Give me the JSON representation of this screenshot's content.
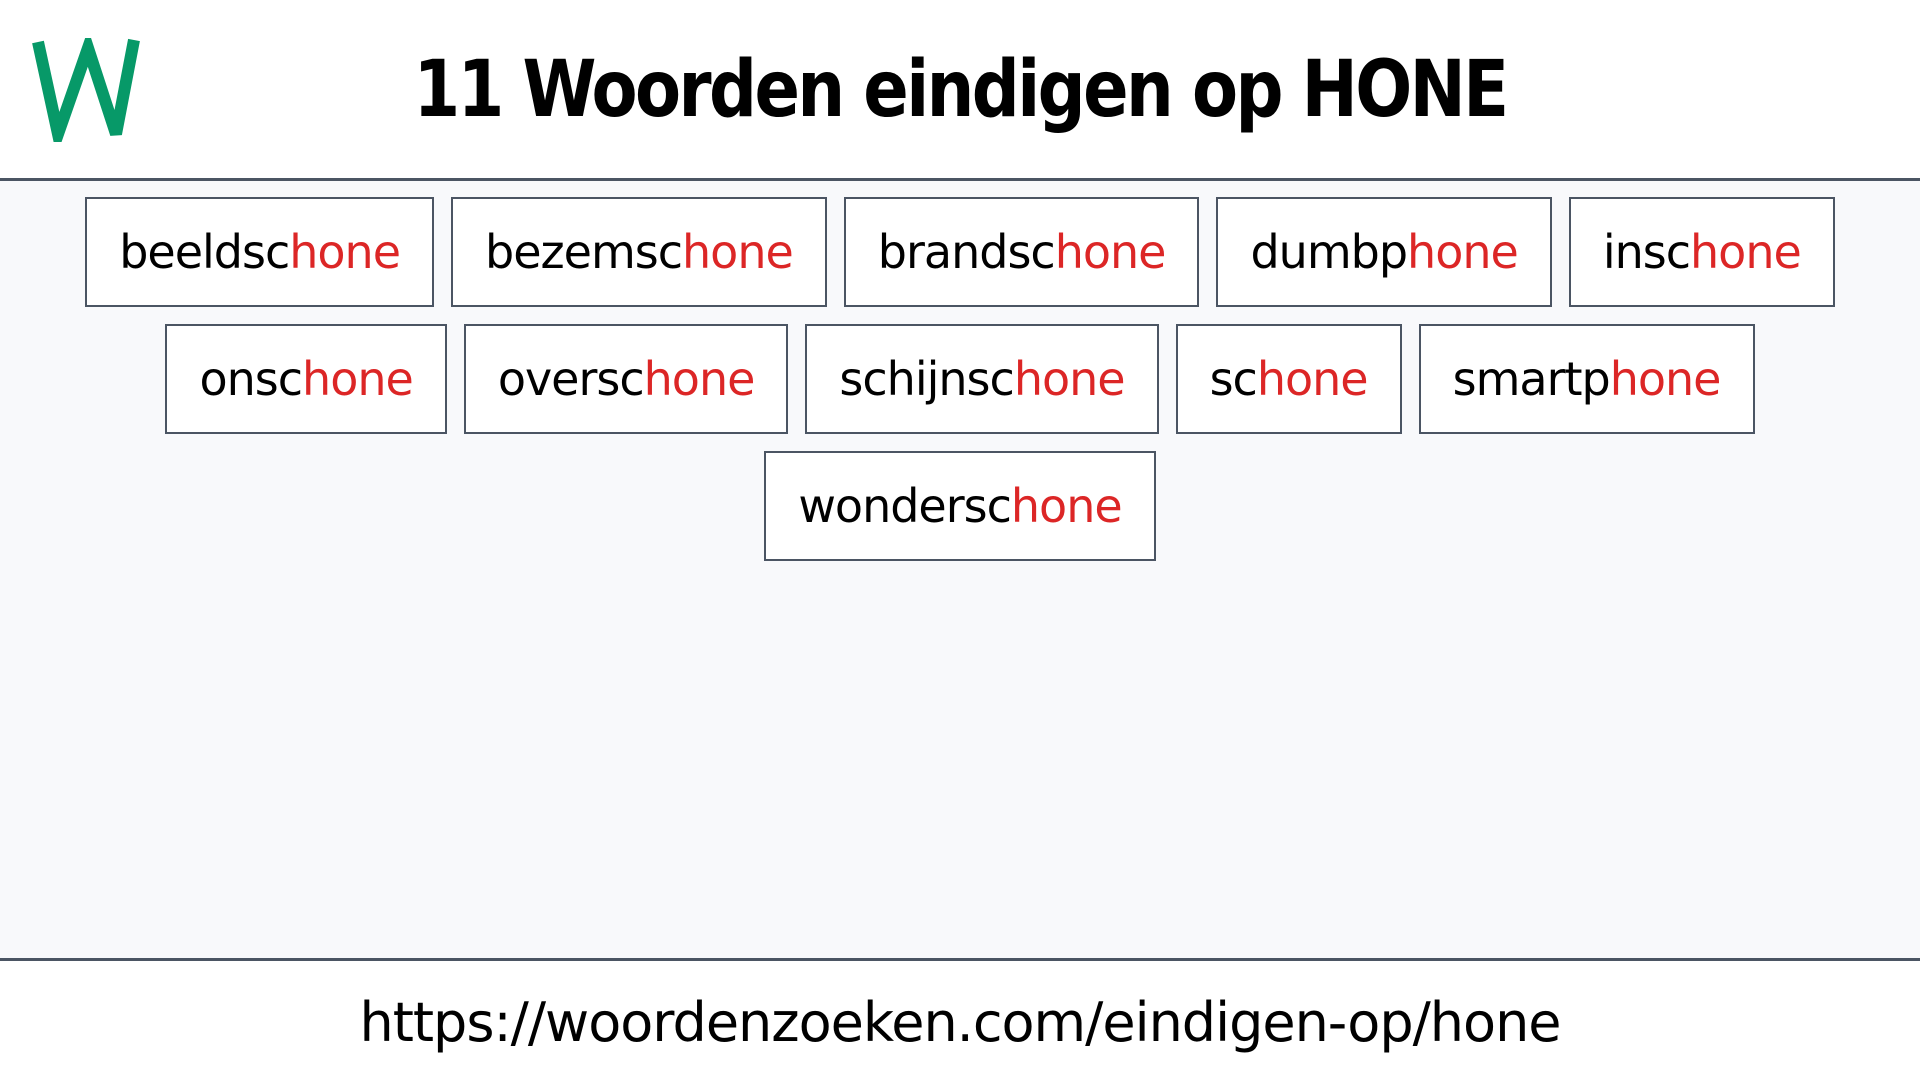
{
  "header": {
    "logo_letter": "W",
    "logo_color": "#079968",
    "title": "11 Woorden eindigen op HONE"
  },
  "words": [
    {
      "stem": "beeldsc",
      "suffix": "hone"
    },
    {
      "stem": "bezemsc",
      "suffix": "hone"
    },
    {
      "stem": "brandsc",
      "suffix": "hone"
    },
    {
      "stem": "dumbp",
      "suffix": "hone"
    },
    {
      "stem": "insc",
      "suffix": "hone"
    },
    {
      "stem": "onsc",
      "suffix": "hone"
    },
    {
      "stem": "oversc",
      "suffix": "hone"
    },
    {
      "stem": "schijnsc",
      "suffix": "hone"
    },
    {
      "stem": "sc",
      "suffix": "hone"
    },
    {
      "stem": "smartp",
      "suffix": "hone"
    },
    {
      "stem": "wondersc",
      "suffix": "hone"
    }
  ],
  "colors": {
    "suffix": "#dc2626",
    "border": "#4b5563",
    "background": "#f8f9fb"
  },
  "footer": {
    "url": "https://woordenzoeken.com/eindigen-op/hone"
  }
}
